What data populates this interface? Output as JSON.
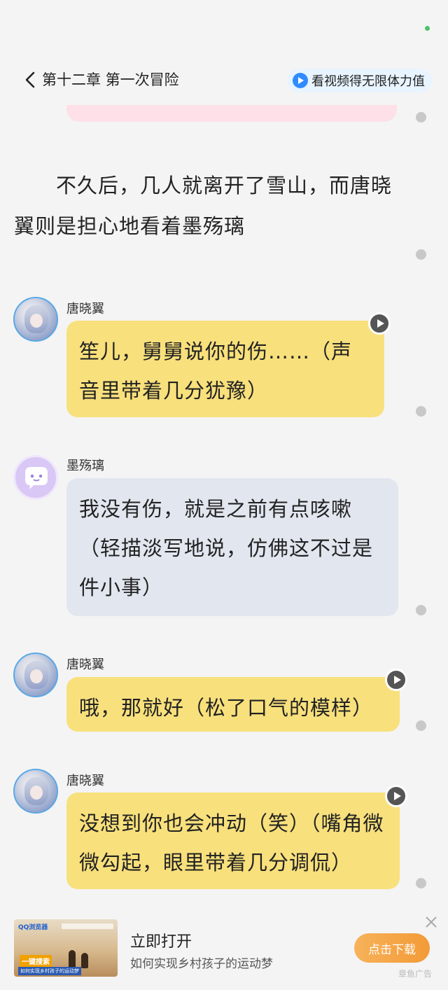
{
  "header": {
    "chapter_title": "第十二章  第一次冒险",
    "video_button_label": "看视频得无限体力值"
  },
  "narration": "不久后，几人就离开了雪山，而唐晓翼则是担心地看着墨殇璃",
  "messages": [
    {
      "speaker": "唐晓翼",
      "text": "笙儿，舅舅说你的伤……（声音里带着几分犹豫）"
    },
    {
      "speaker": "墨殇璃",
      "text": "我没有伤，就是之前有点咳嗽（轻描淡写地说，仿佛这不过是件小事）"
    },
    {
      "speaker": "唐晓翼",
      "text": "哦，那就好（松了口气的模样）"
    },
    {
      "speaker": "唐晓翼",
      "text": "没想到你也会冲动（笑）（嘴角微微勾起，眼里带着几分调侃）"
    }
  ],
  "ad": {
    "thumb_logo": "QQ浏览器",
    "thumb_keyword": "一键搜索",
    "thumb_subtitle": "如何实现乡村孩子的运动梦",
    "title": "立即打开",
    "description": "如何实现乡村孩子的运动梦",
    "cta_label": "点击下载",
    "tag": "章鱼广告"
  },
  "colors": {
    "bubble_yellow": "#f8e07c",
    "bubble_blue": "#e1e6ef",
    "cta_orange": "#f39a37",
    "accent_blue": "#2f8cff"
  }
}
